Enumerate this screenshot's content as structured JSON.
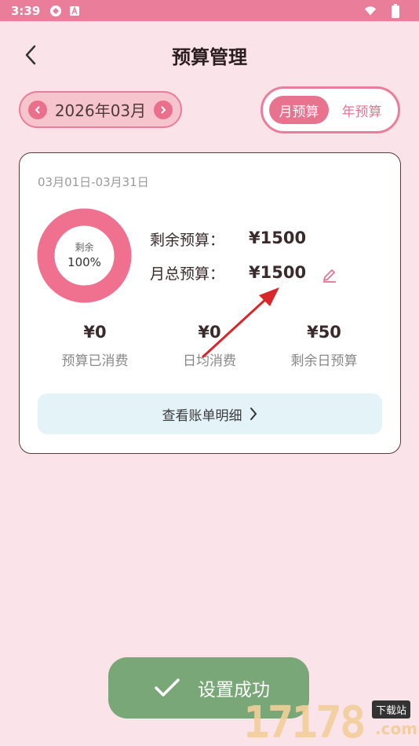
{
  "status_bar": {
    "time": "3:39"
  },
  "header": {
    "title": "预算管理"
  },
  "month_picker": {
    "label": "2026年03月"
  },
  "toggle": {
    "month_label": "月预算",
    "year_label": "年预算",
    "selected": "月预算"
  },
  "card": {
    "date_range": "03月01日-03月31日",
    "donut": {
      "label": "剩余",
      "percent": "100%",
      "remaining_fraction": 1.0
    },
    "remaining_label": "剩余预算：",
    "remaining_value": "¥1500",
    "total_label": "月总预算：",
    "total_value": "¥1500",
    "stats": [
      {
        "value": "¥0",
        "label": "预算已消费"
      },
      {
        "value": "¥0",
        "label": "日均消费"
      },
      {
        "value": "¥50",
        "label": "剩余日预算"
      }
    ],
    "detail_button": "查看账单明细"
  },
  "toast": {
    "message": "设置成功"
  },
  "watermark": {
    "digits": "17178",
    "tag": "下载站",
    "suffix": ".com"
  },
  "colors": {
    "accent": "#ea7e9a",
    "background": "#fbe3ea",
    "donut": "#f07090",
    "toast": "#79a777"
  },
  "icons": [
    "back-arrow-icon",
    "chevron-left-icon",
    "chevron-right-icon",
    "edit-pencil-icon",
    "checkmark-icon",
    "wifi-icon",
    "battery-icon"
  ]
}
